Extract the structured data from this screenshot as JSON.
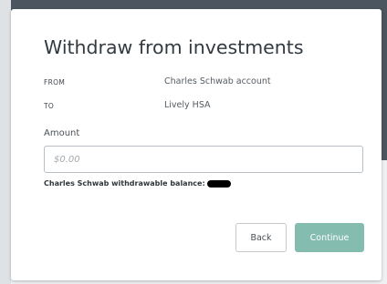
{
  "dialog": {
    "title": "Withdraw from investments",
    "from_label": "FROM",
    "from_value": "Charles Schwab account",
    "to_label": "TO",
    "to_value": "Lively HSA",
    "amount_label": "Amount",
    "amount_placeholder": "$0.00",
    "amount_value": "",
    "balance_label": "Charles Schwab withdrawable balance:",
    "balance_value_redacted": true,
    "back_label": "Back",
    "continue_label": "Continue"
  },
  "colors": {
    "primary_button": "#84bdb0",
    "backdrop": "#4a5560",
    "redaction": "#000000"
  }
}
